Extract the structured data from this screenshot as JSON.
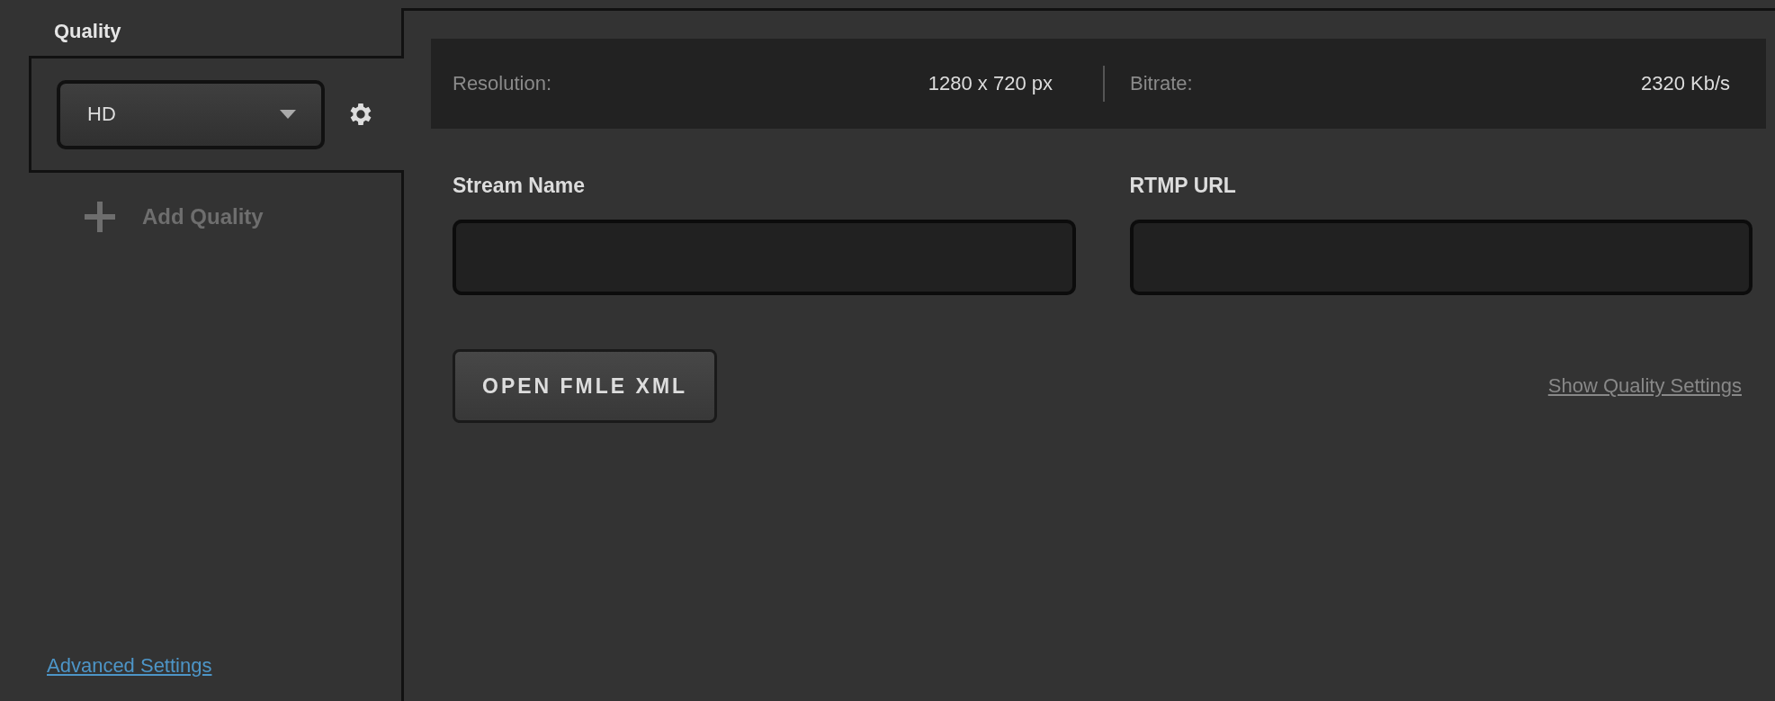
{
  "sidebar": {
    "title": "Quality",
    "qualities": [
      {
        "label": "HD",
        "selected": true
      }
    ],
    "add_quality": "Add Quality",
    "advanced_link": "Advanced Settings"
  },
  "info_bar": [
    {
      "label": "Resolution:",
      "value": "1280 x 720 px"
    },
    {
      "label": "Bitrate:",
      "value": "2320 Kb/s"
    }
  ],
  "fields": [
    {
      "label": "Stream Name"
    },
    {
      "label": "RTMP URL"
    }
  ],
  "open_button": "OPEN FMLE XML",
  "settings_link": "Show Quality Settings"
}
